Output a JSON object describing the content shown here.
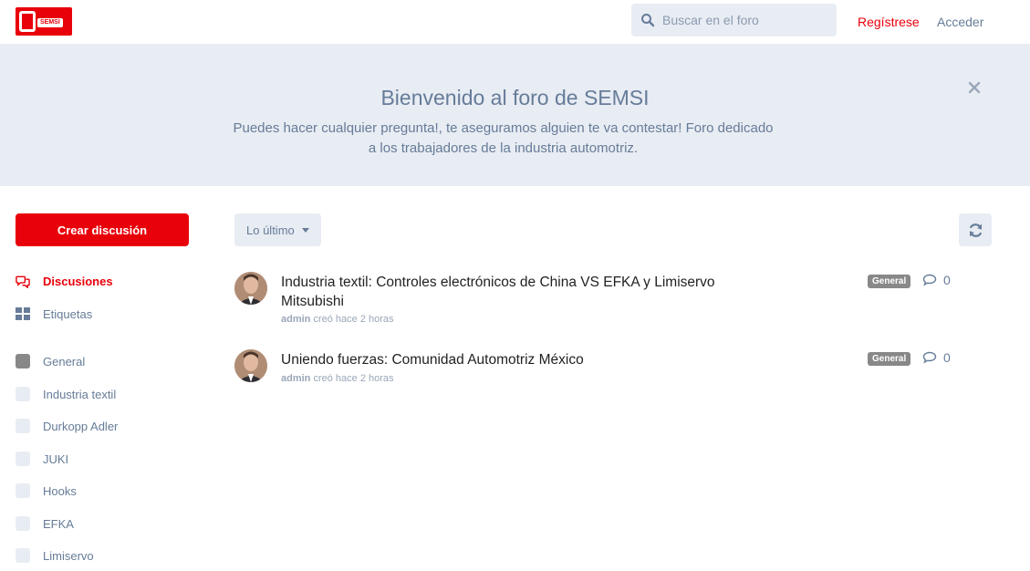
{
  "header": {
    "logo_text": "SEMSI",
    "search_placeholder": "Buscar en el foro",
    "signup_label": "Regístrese",
    "login_label": "Acceder"
  },
  "hero": {
    "title": "Bienvenido al foro de SEMSI",
    "description": "Puedes hacer cualquier pregunta!, te aseguramos alguien te va contestar! Foro dedicado a los trabajadores de la industria automotriz."
  },
  "sidebar": {
    "new_discussion_label": "Crear discusión",
    "nav": [
      {
        "label": "Discusiones",
        "icon": "comments-icon"
      },
      {
        "label": "Etiquetas",
        "icon": "tags-grid-icon"
      }
    ],
    "tags": [
      {
        "label": "General",
        "color": "#888888"
      },
      {
        "label": "Industria textil",
        "color": "#e8ecf3"
      },
      {
        "label": "Durkopp Adler",
        "color": "#e8ecf3"
      },
      {
        "label": "JUKI",
        "color": "#e8ecf3"
      },
      {
        "label": "Hooks",
        "color": "#e8ecf3"
      },
      {
        "label": "EFKA",
        "color": "#e8ecf3"
      },
      {
        "label": "Limiservo",
        "color": "#e8ecf3"
      }
    ]
  },
  "toolbar": {
    "sort_label": "Lo último"
  },
  "discussions": [
    {
      "title": "Industria textil: Controles electrónicos de China VS EFKA y Limiservo Mitsubishi",
      "author": "admin",
      "meta": "creó hace 2 horas",
      "tag": "General",
      "replies": "0"
    },
    {
      "title": "Uniendo fuerzas: Comunidad Automotriz México",
      "author": "admin",
      "meta": "creó hace 2 horas",
      "tag": "General",
      "replies": "0"
    }
  ],
  "colors": {
    "brand": "#e8000a",
    "muted": "#667c99",
    "panel": "#e8ecf3"
  }
}
